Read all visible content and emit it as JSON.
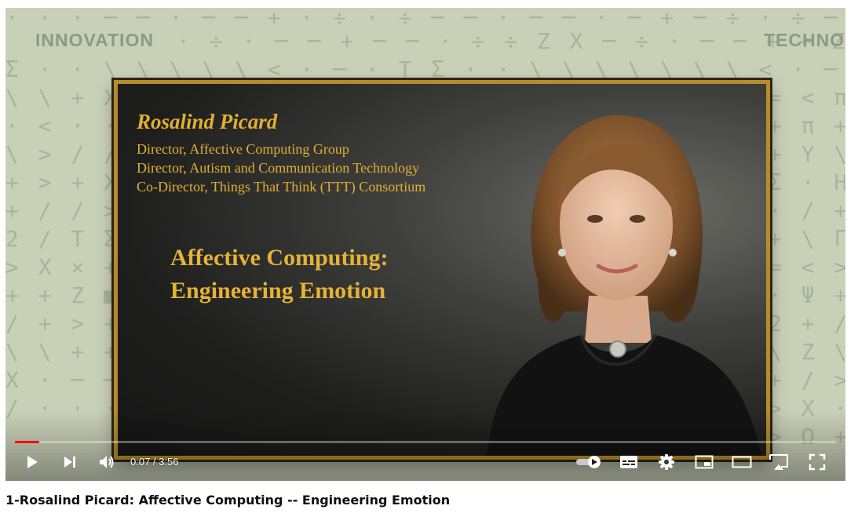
{
  "video": {
    "title": "1-Rosalind Picard: Affective Computing -- Engineering Emotion",
    "background_words": [
      "INNOVATION",
      "TECHNO"
    ],
    "slide": {
      "speaker_name": "Rosalind Picard",
      "roles": [
        "Director, Affective Computing Group",
        "Director, Autism and Communication Technology",
        "Co-Director, Things That Think (TTT) Consortium"
      ],
      "talk_title_line1": "Affective Computing:",
      "talk_title_line2": "Engineering Emotion"
    }
  },
  "player": {
    "current_time": "0:07",
    "duration": "3:56",
    "time_display": "0:07 / 3:56",
    "progress_fraction": 0.03,
    "accent_color": "#ff0000",
    "autoplay_on": true,
    "controls": {
      "left": [
        "play-icon",
        "next-icon",
        "volume-icon"
      ],
      "right": [
        "autoplay-toggle",
        "subtitles-icon",
        "settings-icon",
        "miniplayer-icon",
        "theater-icon",
        "cast-icon",
        "fullscreen-icon"
      ]
    }
  }
}
